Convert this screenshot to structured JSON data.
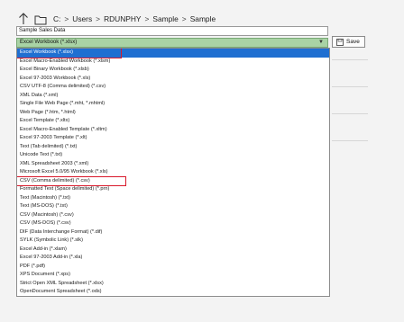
{
  "nav": {
    "path": [
      "C:",
      "Users",
      "RDUNPHY",
      "Sample",
      "Sample"
    ],
    "separator": ">"
  },
  "file_name": {
    "value": "Sample Sales Data"
  },
  "file_type": {
    "selected": "Excel Workbook (*.xlsx)"
  },
  "save_button": {
    "label": "Save"
  },
  "options": [
    "Excel Workbook (*.xlsx)",
    "Excel Macro-Enabled Workbook (*.xlsm)",
    "Excel Binary Workbook (*.xlsb)",
    "Excel 97-2003 Workbook (*.xls)",
    "CSV UTF-8 (Comma delimited) (*.csv)",
    "XML Data (*.xml)",
    "Single File Web Page (*.mht, *.mhtml)",
    "Web Page (*.htm, *.html)",
    "Excel Template (*.xltx)",
    "Excel Macro-Enabled Template (*.xltm)",
    "Excel 97-2003 Template (*.xlt)",
    "Text (Tab delimited) (*.txt)",
    "Unicode Text (*.txt)",
    "XML Spreadsheet 2003 (*.xml)",
    "Microsoft Excel 5.0/95 Workbook (*.xls)",
    "CSV (Comma delimited) (*.csv)",
    "Formatted Text (Space delimited) (*.prn)",
    "Text (Macintosh) (*.txt)",
    "Text (MS-DOS) (*.txt)",
    "CSV (Macintosh) (*.csv)",
    "CSV (MS-DOS) (*.csv)",
    "DIF (Data Interchange Format) (*.dif)",
    "SYLK (Symbolic Link) (*.slk)",
    "Excel Add-in (*.xlam)",
    "Excel 97-2003 Add-in (*.xla)",
    "PDF (*.pdf)",
    "XPS Document (*.xps)",
    "Strict Open XML Spreadsheet (*.xlsx)",
    "OpenDocument Spreadsheet (*.ods)"
  ],
  "selected_index": 0,
  "highlighted_indices": [
    0,
    15
  ],
  "colors": {
    "selection": "#1f6fd1",
    "highlight_box": "#d8192b",
    "file_type_bg": "#a9d3a5"
  }
}
